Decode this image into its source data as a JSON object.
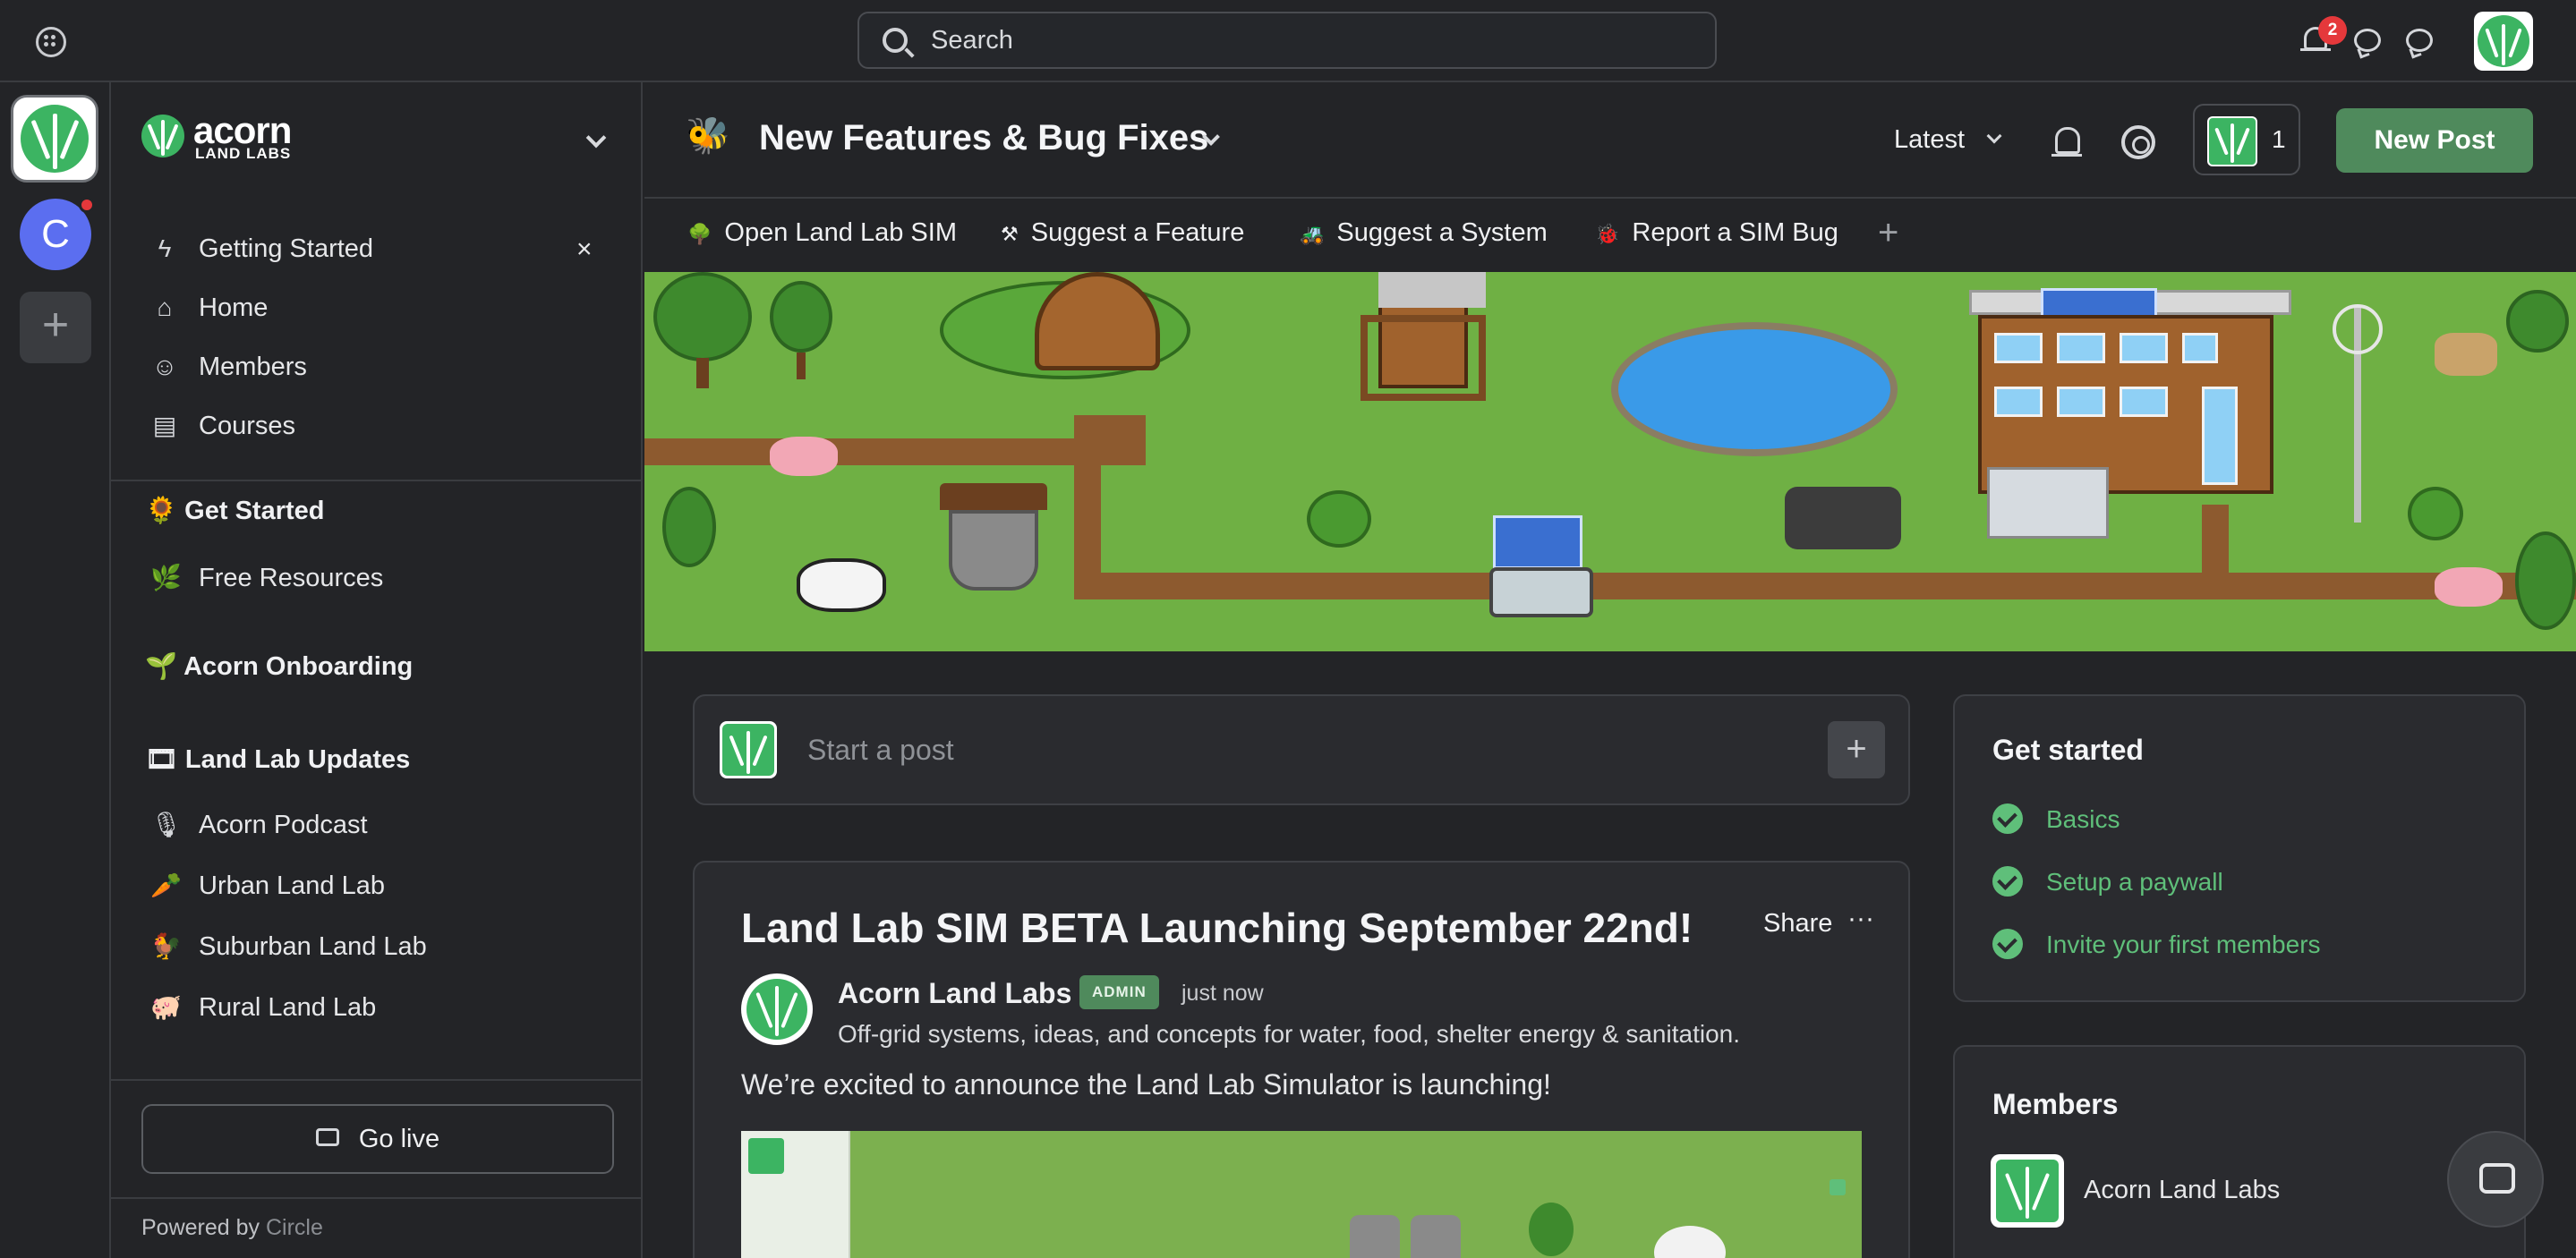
{
  "topbar": {
    "search_placeholder": "Search",
    "notification_count": "2"
  },
  "community": {
    "brand_name": "acorn",
    "brand_sub": "LAND LABS",
    "rail_initial": "C"
  },
  "sidebar": {
    "nav": [
      {
        "label": "Getting Started",
        "icon": "lightning-icon"
      },
      {
        "label": "Home",
        "icon": "home-icon"
      },
      {
        "label": "Members",
        "icon": "members-icon"
      },
      {
        "label": "Courses",
        "icon": "courses-icon"
      }
    ],
    "close_label": "×",
    "groups": [
      {
        "title": "🌻 Get Started",
        "items": [
          {
            "label": "Free Resources",
            "emoji": "🌿"
          }
        ]
      },
      {
        "title": "🌱 Acorn Onboarding",
        "items": []
      },
      {
        "title": "🎞 Land Lab Updates",
        "items": [
          {
            "label": "Acorn Podcast",
            "emoji": "🎙"
          },
          {
            "label": "Urban Land Lab",
            "emoji": "🥕"
          },
          {
            "label": "Suburban Land Lab",
            "emoji": "🐓"
          },
          {
            "label": "Rural Land Lab",
            "emoji": "🐖"
          }
        ]
      }
    ],
    "go_live": "Go live",
    "powered_by": "Powered by",
    "powered_brand": "Circle"
  },
  "space": {
    "emoji": "🐝",
    "title": "New Features & Bug Fixes",
    "sort": "Latest",
    "member_count": "1",
    "new_post": "New Post",
    "tabs": [
      {
        "emoji": "🌳",
        "label": "Open Land Lab SIM"
      },
      {
        "emoji": "⚒",
        "label": "Suggest a Feature"
      },
      {
        "emoji": "🚜",
        "label": "Suggest a System"
      },
      {
        "emoji": "🐞",
        "label": "Report a SIM Bug"
      }
    ],
    "tab_add": "+"
  },
  "composer": {
    "placeholder": "Start a post",
    "plus": "+"
  },
  "post": {
    "title": "Land Lab SIM BETA Launching September 22nd!",
    "share": "Share",
    "more": "···",
    "author": "Acorn Land Labs",
    "role": "ADMIN",
    "time": "just now",
    "bio": "Off-grid systems, ideas, and concepts for water, food, shelter energy & sanitation.",
    "body": "We’re excited to announce the Land Lab Simulator is launching!"
  },
  "get_started": {
    "title": "Get started",
    "items": [
      "Basics",
      "Setup a paywall",
      "Invite your first members"
    ]
  },
  "members": {
    "title": "Members",
    "list": [
      "Acorn Land Labs"
    ]
  },
  "colors": {
    "accent": "#4f8a5c",
    "link_green": "#5fbf7a",
    "badge_red": "#e5383b",
    "background": "#232427"
  }
}
